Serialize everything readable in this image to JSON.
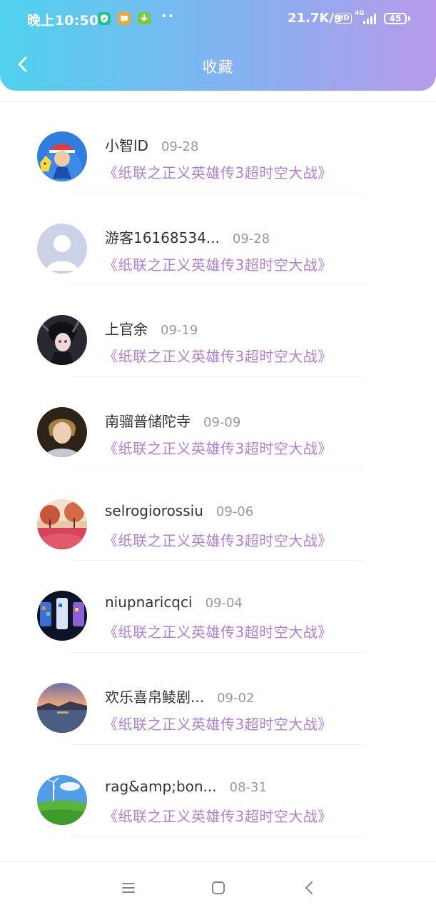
{
  "status_bar": {
    "time": "晚上10:50",
    "dots": "··",
    "net_speed": "21.7K/s",
    "hd": "HD",
    "network_type": "4G",
    "battery": "45",
    "icons": [
      "shield-app-icon",
      "message-app-icon",
      "download-app-icon",
      "signal-icon",
      "battery-icon"
    ],
    "app_colors": [
      "#1ec28b",
      "#f6a531",
      "#7bc943"
    ]
  },
  "header": {
    "title": "收藏",
    "back_icon": "chevron-left-icon",
    "gradient": [
      "#4fd2ee",
      "#b79aeb"
    ]
  },
  "favorites": [
    {
      "name": "小智lD",
      "date": "09-28",
      "game": "《纸联之正义英雄传3超时空大战》",
      "avatar": "pokemon-trainer"
    },
    {
      "name": "游客16168534...",
      "date": "09-28",
      "game": "《纸联之正义英雄传3超时空大战》",
      "avatar": "default-avatar"
    },
    {
      "name": "上官余",
      "date": "09-19",
      "game": "《纸联之正义英雄传3超时空大战》",
      "avatar": "dark-anime"
    },
    {
      "name": "南骝普储陀寺",
      "date": "09-09",
      "game": "《纸联之正义英雄传3超时空大战》",
      "avatar": "child-photo"
    },
    {
      "name": "selrogiorossiu",
      "date": "09-06",
      "game": "《纸联之正义英雄传3超时空大战》",
      "avatar": "autumn-trees"
    },
    {
      "name": "niupnaricqci",
      "date": "09-04",
      "game": "《纸联之正义英雄传3超时空大战》",
      "avatar": "phone-screens"
    },
    {
      "name": "欢乐喜帛鲮剧...",
      "date": "09-02",
      "game": "《纸联之正义英雄传3超时空大战》",
      "avatar": "sunset-lake"
    },
    {
      "name": "rag&amp;bon...",
      "date": "08-31",
      "game": "《纸联之正义英雄传3超时空大战》",
      "avatar": "green-field"
    }
  ],
  "colors": {
    "accent_link": "#b07fd6",
    "name_text": "#333333",
    "date_text": "#999999"
  },
  "nav_bar": {
    "icons": [
      "menu-icon",
      "home-icon",
      "back-icon"
    ]
  }
}
